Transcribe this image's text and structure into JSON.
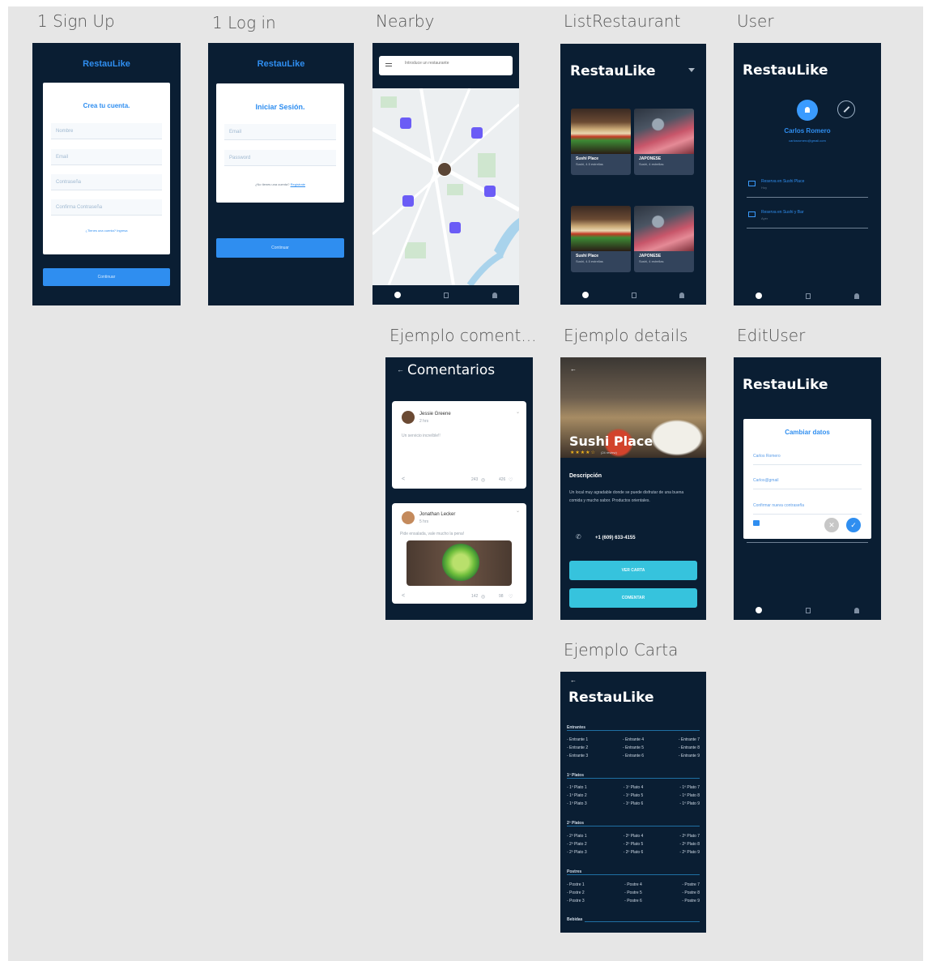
{
  "frames": {
    "signup": {
      "label": "1 Sign Up",
      "brand": "RestauLike",
      "heading": "Crea tu cuenta.",
      "fields": [
        "Nombre",
        "Email",
        "Contraseña",
        "Confirma Contraseña"
      ],
      "link": "¿Tienes una cuenta? Ingresa",
      "button": "Continuar"
    },
    "login": {
      "label": "1 Log in",
      "brand": "RestauLike",
      "heading": "Iniciar Sesión.",
      "fields": [
        "Email",
        "Password"
      ],
      "link_prefix": "¿No tienes una cuenta?",
      "link_action": "Regístrate",
      "button": "Continuar"
    },
    "nearby": {
      "label": "Nearby",
      "search_placeholder": "Introduce un restaurante"
    },
    "list": {
      "label": "ListRestaurant",
      "title": "RestauLike",
      "cards": [
        {
          "name": "Sushi Place",
          "sub": "Sushi, 4.5 estrellas"
        },
        {
          "name": "JAPONESE",
          "sub": "Sushi, 4 estrellas"
        },
        {
          "name": "Sushi Place",
          "sub": "Sushi, 4.5 estrellas"
        },
        {
          "name": "JAPONESE",
          "sub": "Sushi, 4 estrellas"
        }
      ]
    },
    "user": {
      "label": "User",
      "title": "RestauLike",
      "name": "Carlos Romero",
      "email": "carlosromero@gmail.com",
      "items": [
        {
          "title": "Reserva en Sushi Place",
          "sub": "Hoy"
        },
        {
          "title": "Reserva en Sushi y Bar",
          "sub": "Ayer"
        }
      ]
    },
    "comments": {
      "label": "Ejemplo coment...",
      "title": "Comentarios",
      "posts": [
        {
          "author": "Jessie Greene",
          "time": "2 hrs",
          "text": "Un servicio increíble!!",
          "shares": "243",
          "likes": "426"
        },
        {
          "author": "Jonathan Lecker",
          "time": "5 hrs",
          "text": "Pide ensalada, vale mucho la pena!",
          "shares": "142",
          "likes": "98"
        }
      ]
    },
    "details": {
      "label": "Ejemplo details",
      "name": "Sushi Place",
      "rating_text": "(24 review)",
      "section": "Descripción",
      "description": "Un local muy agradable donde se puede disfrutar de una buena comida y mucho sabor. Productos orientales.",
      "phone": "+1 (609) 633-4155",
      "btn1": "VER CARTA",
      "btn2": "COMENTAR"
    },
    "edituser": {
      "label": "EditUser",
      "title": "RestauLike",
      "modal_title": "Cambiar datos",
      "fields": [
        "Carlos Romero",
        "Carlos@gmail",
        "Confirmar nueva contraseña"
      ]
    },
    "carta": {
      "label": "Ejemplo Carta",
      "title": "RestauLike",
      "sections": [
        {
          "head": "Entrantes",
          "rows": [
            [
              "- Entrante 1",
              "- Entrante 4",
              "- Entrante 7"
            ],
            [
              "- Entrante 2",
              "- Entrante 5",
              "- Entrante 8"
            ],
            [
              "- Entrante 3",
              "- Entrante 6",
              "- Entrante 9"
            ]
          ]
        },
        {
          "head": "1º Platos",
          "rows": [
            [
              "- 1º Plato 1",
              "- 1º Plato 4",
              "- 1º Plato 7"
            ],
            [
              "- 1º Plato 2",
              "- 1º Plato 5",
              "- 1º Plato 8"
            ],
            [
              "- 1º Plato 3",
              "- 1º Plato 6",
              "- 1º Plato 9"
            ]
          ]
        },
        {
          "head": "2º Platos",
          "rows": [
            [
              "- 2º Plato 1",
              "- 2º Plato 4",
              "- 2º Plato 7"
            ],
            [
              "- 2º Plato 2",
              "- 2º Plato 5",
              "- 2º Plato 8"
            ],
            [
              "- 2º Plato 3",
              "- 2º Plato 6",
              "- 2º Plato 9"
            ]
          ]
        },
        {
          "head": "Postres",
          "rows": [
            [
              "- Postre 1",
              "- Postre 4",
              "- Postre 7"
            ],
            [
              "- Postre 2",
              "- Postre 5",
              "- Postre 8"
            ],
            [
              "- Postre 3",
              "- Postre 6",
              "- Postre 9"
            ]
          ]
        },
        {
          "head": "Bebidas",
          "rows": []
        }
      ]
    }
  }
}
